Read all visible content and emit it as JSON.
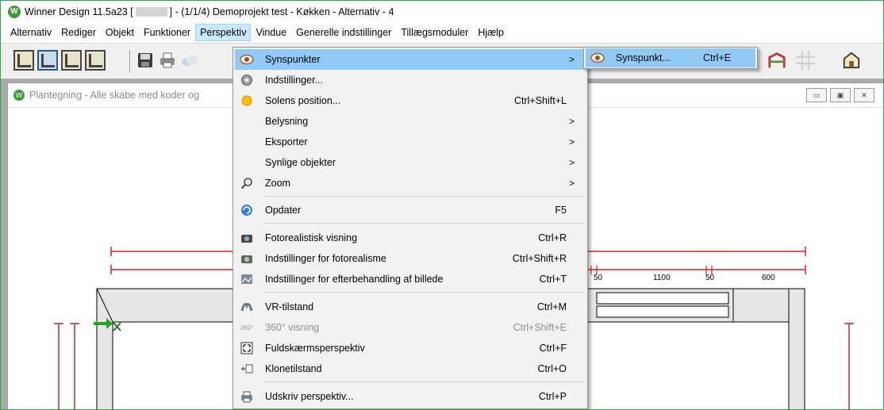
{
  "window": {
    "title_prefix": "Winner Design 11.5a23 [",
    "title_suffix": "] - (1/1/4) Demoprojekt test - Køkken - Alternativ - 4"
  },
  "menubar": {
    "items": [
      "Alternativ",
      "Rediger",
      "Objekt",
      "Funktioner",
      "Perspektiv",
      "Vindue",
      "Generelle indstillinger",
      "Tillægsmoduler",
      "Hjælp"
    ],
    "active": "Perspektiv"
  },
  "child_window": {
    "title": "Plantegning - Alle skabe med koder og"
  },
  "drawing": {
    "dimension_labels": [
      "50",
      "1100",
      "50",
      "600"
    ]
  },
  "perspektiv_menu": {
    "items": [
      {
        "label": "Synspunkter",
        "shortcut": "",
        "submenu": true,
        "icon": "eye-icon",
        "highlighted": true
      },
      {
        "label": "Indstillinger...",
        "shortcut": "",
        "submenu": false,
        "icon": "gear-icon"
      },
      {
        "label": "Solens position...",
        "shortcut": "Ctrl+Shift+L",
        "submenu": false,
        "icon": "sun-icon"
      },
      {
        "label": "Belysning",
        "shortcut": "",
        "submenu": true,
        "icon": ""
      },
      {
        "label": "Eksporter",
        "shortcut": "",
        "submenu": true,
        "icon": ""
      },
      {
        "label": "Synlige objekter",
        "shortcut": "",
        "submenu": true,
        "icon": ""
      },
      {
        "label": "Zoom",
        "shortcut": "",
        "submenu": true,
        "icon": "magnifier-icon"
      },
      {
        "label": "Opdater",
        "shortcut": "F5",
        "submenu": false,
        "icon": "refresh-icon"
      },
      {
        "label": "Fotorealistisk visning",
        "shortcut": "Ctrl+R",
        "submenu": false,
        "icon": "camera-icon"
      },
      {
        "label": "Indstillinger for fotorealisme",
        "shortcut": "Ctrl+Shift+R",
        "submenu": false,
        "icon": "camera-settings-icon"
      },
      {
        "label": "Indstillinger for efterbehandling af billede",
        "shortcut": "Ctrl+T",
        "submenu": false,
        "icon": "image-settings-icon"
      },
      {
        "label": "VR-tilstand",
        "shortcut": "Ctrl+M",
        "submenu": false,
        "icon": "vr-icon"
      },
      {
        "label": "360° visning",
        "shortcut": "Ctrl+Shift+E",
        "submenu": false,
        "icon": "360-icon",
        "disabled": true
      },
      {
        "label": "Fuldskærmsperspektiv",
        "shortcut": "Ctrl+F",
        "submenu": false,
        "icon": "fullscreen-icon"
      },
      {
        "label": "Klonetilstand",
        "shortcut": "Ctrl+O",
        "submenu": false,
        "icon": "clone-icon"
      },
      {
        "label": "Udskriv perspektiv...",
        "shortcut": "Ctrl+P",
        "submenu": false,
        "icon": "printer-icon"
      }
    ],
    "submenu_arrow": ">",
    "icon_360_text": "360°"
  },
  "synspunkter_submenu": {
    "item": {
      "label": "Synspunkt...",
      "shortcut": "Ctrl+E",
      "icon": "eye-icon"
    }
  },
  "colors": {
    "accent_green": "#2ba84a",
    "menu_highlight": "#91c9f7",
    "dimension_red": "#d62020"
  }
}
